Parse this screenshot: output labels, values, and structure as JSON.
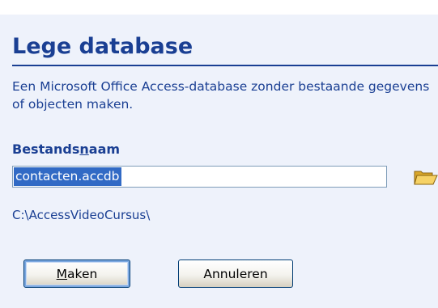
{
  "dialog": {
    "title": "Lege database",
    "description": "Een Microsoft Office Access-database zonder bestaande gegevens of objecten maken.",
    "filename_label_pre": "Bestands",
    "filename_label_accel": "n",
    "filename_label_post": "aam",
    "filename_value": "contacten.accdb",
    "path": "C:\\AccessVideoCursus\\",
    "browse_icon": "folder-open-icon",
    "buttons": {
      "create_accel": "M",
      "create_rest": "aken",
      "cancel_label": "Annuleren"
    }
  },
  "colors": {
    "heading": "#1a3f93",
    "panel_bg": "#eef2fb",
    "selection": "#316ac5"
  }
}
